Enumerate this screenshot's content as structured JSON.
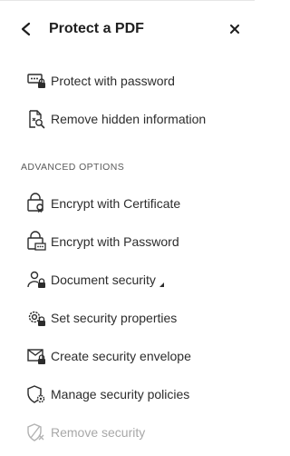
{
  "header": {
    "title": "Protect a PDF"
  },
  "primary_items": [
    {
      "label": "Protect with password",
      "icon": "password-field-lock-icon"
    },
    {
      "label": "Remove hidden information",
      "icon": "document-search-icon"
    }
  ],
  "section": {
    "label": "ADVANCED OPTIONS"
  },
  "advanced_items": [
    {
      "label": "Encrypt with Certificate",
      "icon": "certificate-lock-icon"
    },
    {
      "label": "Encrypt with Password",
      "icon": "password-lock-icon"
    },
    {
      "label": "Document security",
      "icon": "user-lock-icon"
    },
    {
      "label": "Set security properties",
      "icon": "gear-lock-icon"
    },
    {
      "label": "Create security envelope",
      "icon": "envelope-lock-icon"
    },
    {
      "label": "Manage security policies",
      "icon": "shield-gear-icon"
    },
    {
      "label": "Remove security",
      "icon": "shield-remove-icon",
      "disabled": true
    }
  ]
}
